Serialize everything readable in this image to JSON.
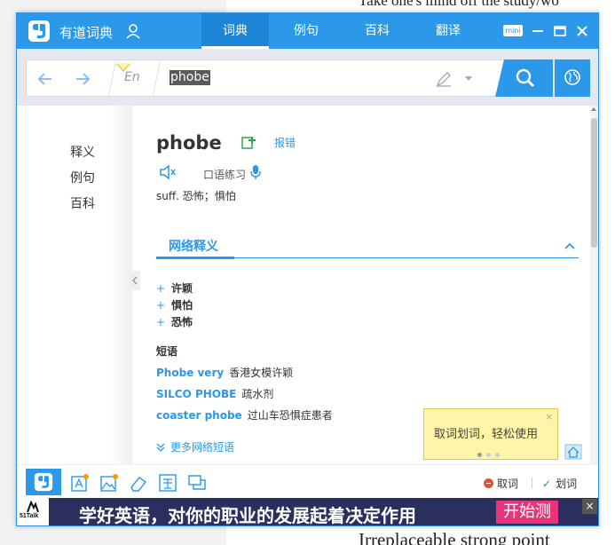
{
  "background_doc": {
    "top_line": "Take one's mind off the study/wo",
    "bottom_line": "Irreplaceable strong point"
  },
  "titlebar": {
    "app_name": "有道词典",
    "tabs": [
      {
        "label": "词典",
        "active": true
      },
      {
        "label": "例句",
        "active": false
      },
      {
        "label": "百科",
        "active": false
      },
      {
        "label": "翻译",
        "active": false
      }
    ],
    "mini_label": "mini"
  },
  "search": {
    "lang_label": "En",
    "query": "phobe"
  },
  "side_nav": {
    "items": [
      "释义",
      "例句",
      "百科"
    ]
  },
  "entry": {
    "word": "phobe",
    "report_label": "报错",
    "oral_practice_label": "口语练习",
    "meaning": "suff. 恐怖；惧怕"
  },
  "web_meaning": {
    "tab_label": "网络释义",
    "items": [
      "许颖",
      "惧怕",
      "恐怖"
    ],
    "phrases_title": "短语",
    "phrases": [
      {
        "en": "Phobe very",
        "zh": "香港女模许颖"
      },
      {
        "en": "SILCO PHOBE",
        "zh": "疏水剂"
      },
      {
        "en": "coaster phobe",
        "zh": "过山车恐惧症患者"
      }
    ],
    "more_label": "更多网络短语"
  },
  "tooltip": {
    "text": "取词划词，轻松使用",
    "close": "×"
  },
  "toolbar": {
    "cancel_label": "取词",
    "select_label": "划词"
  },
  "ad": {
    "logo_text": "51Talk",
    "text": "学好英语，对你的职业的发展起着决定作用",
    "cta": "开始测试",
    "close": "×"
  },
  "colors": {
    "brand_blue": "#2b98ea",
    "ad_bg": "#2a2f5e",
    "ad_cta": "#e8357a",
    "tooltip_bg": "#fff5a8"
  }
}
